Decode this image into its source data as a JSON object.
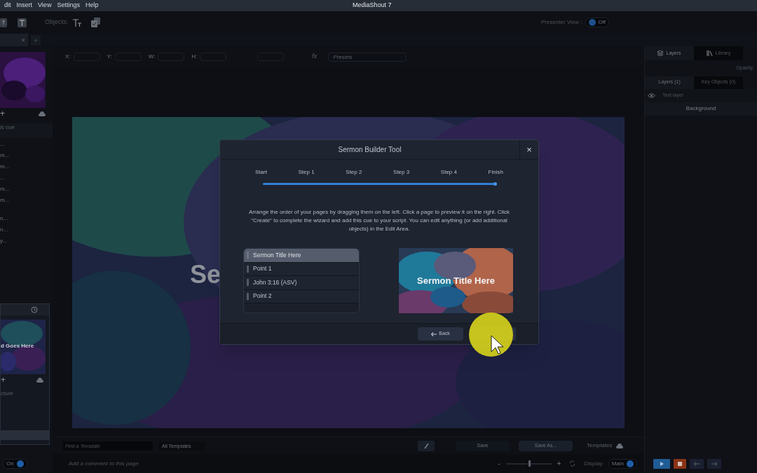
{
  "menu_bar": {
    "items": [
      "dit",
      "Insert",
      "View",
      "Settings",
      "Help"
    ],
    "title": "MediaShout 7"
  },
  "toolbar": {
    "objects_label": "Objects:",
    "presenter_view": {
      "label": "Presenter View :",
      "text": "Off",
      "on": false
    }
  },
  "document_tab": {
    "close": "×",
    "add": "+"
  },
  "properties_bar": {
    "fields": [
      "X:",
      "Y:",
      "W:",
      "H:"
    ],
    "presets": "Presets",
    "formula": "fx"
  },
  "left_panel": {
    "cue_label": "is cue",
    "list_items": [
      "...",
      "m...",
      "m...",
      "...",
      "m...",
      "m...",
      "n...",
      "n...",
      "y..."
    ],
    "thumbnail_text": "d Goes Here",
    "add_icons": [
      "+",
      "+"
    ],
    "bottom_label": "cture",
    "toggle": {
      "text": "On",
      "on": true
    }
  },
  "canvas": {
    "visible_text": "Se"
  },
  "right_panel": {
    "tabs": [
      {
        "label": "Layers",
        "selected": true
      },
      {
        "label": "Library",
        "selected": false
      }
    ],
    "opacity_label": "Opacity:",
    "subtabs": [
      {
        "label": "Layers (1)",
        "selected": true
      },
      {
        "label": "Key Objects (0)",
        "selected": false
      }
    ],
    "layers": [
      {
        "name": "Text layer",
        "visible": true
      }
    ],
    "background_label": "Background"
  },
  "template_bar": {
    "search_placeholder": "Find a Template",
    "filter": "All Templates",
    "buttons": [
      {
        "label": "Save",
        "disabled": true
      },
      {
        "label": "Save As...",
        "disabled": false
      }
    ],
    "templates_label": "Templates"
  },
  "status_bar": {
    "comment_placeholder": "Add a comment to this page",
    "zoom": {
      "minus": "-",
      "plus": "+",
      "level": 0.5
    },
    "display_label": "Display",
    "display_toggle": {
      "text": "Main",
      "on": true
    }
  },
  "dialog": {
    "title": "Sermon Builder Tool",
    "close": "×",
    "steps": [
      "Start",
      "Step 1",
      "Step 2",
      "Step 3",
      "Step 4",
      "Finish"
    ],
    "progress": {
      "level": 1
    },
    "description": "Arrange the order of your pages by dragging them on the left. Click a page to preview it on the right. Click \"Create\" to complete the wizard and add this cue to your script. You can edit anything (or add additional objects) in the Edit Area.",
    "pages": [
      {
        "label": "Sermon Title Here",
        "selected": true
      },
      {
        "label": "Point 1",
        "selected": false
      },
      {
        "label": "John 3:16 (ASV)",
        "selected": false
      },
      {
        "label": "Point 2",
        "selected": false
      }
    ],
    "preview_title": "Sermon Title Here",
    "back_button": "Back"
  }
}
